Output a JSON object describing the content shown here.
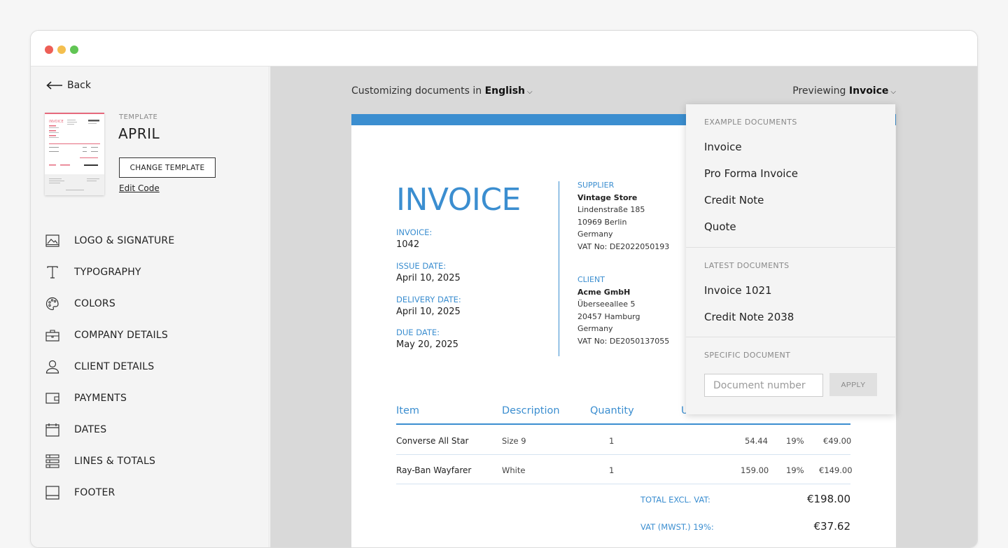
{
  "sidebar": {
    "back_label": "Back",
    "template_label": "TEMPLATE",
    "template_name": "APRIL",
    "change_template": "CHANGE TEMPLATE",
    "edit_code": "Edit Code",
    "thumb_title": "INVOICE",
    "nav": [
      {
        "label": "LOGO & SIGNATURE",
        "icon": "image-icon"
      },
      {
        "label": "TYPOGRAPHY",
        "icon": "typography-icon"
      },
      {
        "label": "COLORS",
        "icon": "palette-icon"
      },
      {
        "label": "COMPANY DETAILS",
        "icon": "briefcase-icon"
      },
      {
        "label": "CLIENT DETAILS",
        "icon": "person-icon"
      },
      {
        "label": "PAYMENTS",
        "icon": "wallet-icon"
      },
      {
        "label": "DATES",
        "icon": "calendar-icon"
      },
      {
        "label": "LINES & TOTALS",
        "icon": "list-icon"
      },
      {
        "label": "FOOTER",
        "icon": "footer-icon"
      }
    ]
  },
  "header": {
    "customizing_prefix": "Customizing documents in",
    "language": "English",
    "previewing_prefix": "Previewing",
    "preview_doc": "Invoice"
  },
  "invoice": {
    "title": "INVOICE",
    "number_label": "INVOICE:",
    "number": "1042",
    "issue_label": "ISSUE DATE:",
    "issue": "April 10, 2025",
    "delivery_label": "DELIVERY DATE:",
    "delivery": "April 10, 2025",
    "due_label": "DUE DATE:",
    "due": "May 20, 2025",
    "supplier": {
      "heading": "SUPPLIER",
      "name": "Vintage Store",
      "street": "Lindenstraße 185",
      "city": "10969 Berlin",
      "country": "Germany",
      "vat": "VAT No: DE2022050193"
    },
    "client": {
      "heading": "CLIENT",
      "name": "Acme GmbH",
      "street": "Überseeallee 5",
      "city": "20457 Hamburg",
      "country": "Germany",
      "vat": "VAT No: DE2050137055"
    },
    "columns": {
      "item": "Item",
      "description": "Description",
      "quantity": "Quantity",
      "unit": "U"
    },
    "lines": [
      {
        "item": "Converse All Star",
        "description": "Size 9",
        "quantity": "1",
        "price": "54.44",
        "vat": "19%",
        "total": "€49.00"
      },
      {
        "item": "Ray-Ban Wayfarer",
        "description": "White",
        "quantity": "1",
        "price": "159.00",
        "vat": "19%",
        "total": "€149.00"
      }
    ],
    "total_excl_label": "TOTAL EXCL. VAT:",
    "total_excl": "€198.00",
    "vat_label": "VAT (MWST.) 19%:",
    "vat_value": "€37.62"
  },
  "dropdown": {
    "example_heading": "EXAMPLE DOCUMENTS",
    "examples": [
      "Invoice",
      "Pro Forma Invoice",
      "Credit Note",
      "Quote"
    ],
    "latest_heading": "LATEST DOCUMENTS",
    "latest": [
      "Invoice 1021",
      "Credit Note 2038"
    ],
    "specific_heading": "SPECIFIC DOCUMENT",
    "doc_placeholder": "Document number",
    "apply": "APPLY"
  },
  "colors": {
    "accent": "#3b8ed0",
    "thumb_accent": "#e66a7d"
  }
}
